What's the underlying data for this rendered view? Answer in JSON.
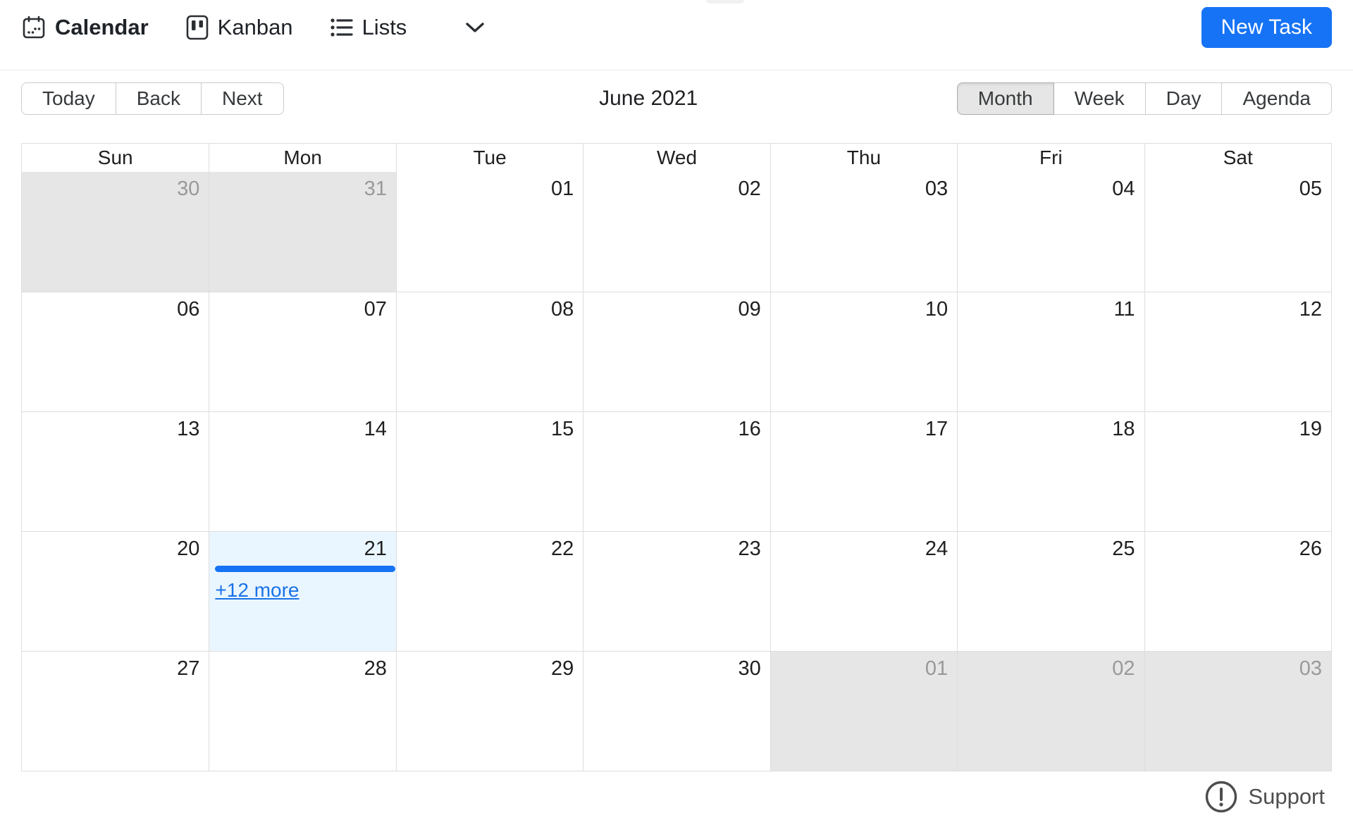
{
  "nav": {
    "tabs": [
      {
        "label": "Calendar",
        "icon": "calendar-icon",
        "active": true
      },
      {
        "label": "Kanban",
        "icon": "kanban-icon",
        "active": false
      },
      {
        "label": "Lists",
        "icon": "lists-icon",
        "active": false
      }
    ],
    "new_task_label": "New Task"
  },
  "toolbar": {
    "today_label": "Today",
    "back_label": "Back",
    "next_label": "Next",
    "title": "June 2021",
    "views": {
      "month": "Month",
      "week": "Week",
      "day": "Day",
      "agenda": "Agenda"
    },
    "active_view": "Month"
  },
  "calendar": {
    "day_headers": [
      "Sun",
      "Mon",
      "Tue",
      "Wed",
      "Thu",
      "Fri",
      "Sat"
    ],
    "weeks": [
      [
        "30",
        "31",
        "01",
        "02",
        "03",
        "04",
        "05"
      ],
      [
        "06",
        "07",
        "08",
        "09",
        "10",
        "11",
        "12"
      ],
      [
        "13",
        "14",
        "15",
        "16",
        "17",
        "18",
        "19"
      ],
      [
        "20",
        "21",
        "22",
        "23",
        "24",
        "25",
        "26"
      ],
      [
        "27",
        "28",
        "29",
        "30",
        "01",
        "02",
        "03"
      ]
    ],
    "off_range_days": [
      "May 30",
      "May 31",
      "Jul 01",
      "Jul 02",
      "Jul 03"
    ],
    "today_date": "21",
    "today_more_link": "+12 more"
  },
  "footer": {
    "support_label": "Support"
  },
  "colors": {
    "accent_blue": "#1673f5",
    "link_blue": "#1a73e8",
    "today_bg": "#eaf6ff",
    "off_range_bg": "#e6e6e6",
    "grid_border": "#dddddd"
  }
}
